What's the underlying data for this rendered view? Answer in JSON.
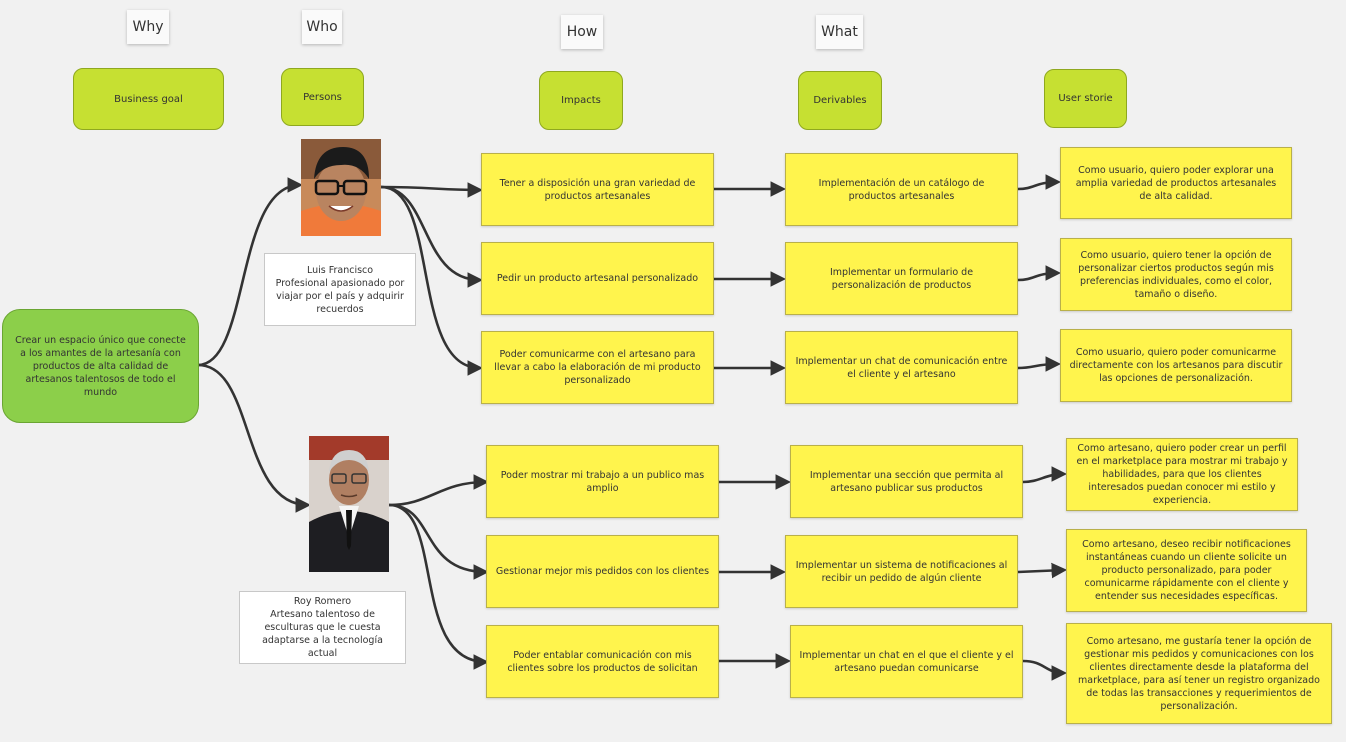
{
  "headers": {
    "why": "Why",
    "who": "Who",
    "how": "How",
    "what": "What"
  },
  "categories": {
    "business_goal": "Business goal",
    "persons": "Persons",
    "impacts": "Impacts",
    "derivables": "Derivables",
    "user_storie": "User storie"
  },
  "goal": "Crear un espacio único que conecte a los amantes de la artesanía con productos de alta calidad de artesanos talentosos de todo el mundo",
  "personas": [
    {
      "name": "Luis Francisco",
      "description": "Profesional apasionado por viajar por el país y adquirir recuerdos"
    },
    {
      "name": "Roy Romero",
      "description": "Artesano talentoso de esculturas que le cuesta adaptarse a la tecnología actual"
    }
  ],
  "impacts": [
    "Tener a disposición una gran variedad de productos artesanales",
    "Pedir un producto artesanal personalizado",
    "Poder comunicarme con el artesano para llevar a cabo la elaboración de mi producto personalizado",
    "Poder mostrar mi trabajo a un publico mas amplio",
    "Gestionar mejor mis pedidos con los clientes",
    "Poder entablar comunicación con mis clientes sobre los productos de solicitan"
  ],
  "derivables": [
    "Implementación de un catálogo de productos artesanales",
    "Implementar un formulario de personalización de productos",
    "Implementar un chat de comunicación entre el cliente y el artesano",
    "Implementar una  sección que permita al artesano publicar sus productos",
    "Implementar un sistema de notificaciones al recibir un pedido de algún cliente",
    "Implementar un chat en el que el cliente y el artesano puedan comunicarse"
  ],
  "user_stories": [
    "Como usuario, quiero poder explorar una amplia variedad de productos artesanales de alta calidad.",
    "Como usuario, quiero tener la opción de personalizar ciertos productos según mis preferencias individuales, como el color, tamaño o diseño.",
    "Como usuario, quiero poder comunicarme directamente con los artesanos para discutir las opciones de personalización.",
    "Como artesano, quiero poder crear un perfil en el marketplace para mostrar mi trabajo y habilidades, para que los clientes interesados puedan conocer mi estilo y experiencia.",
    "Como artesano, deseo recibir notificaciones instantáneas cuando un cliente solicite un producto personalizado, para poder comunicarme rápidamente con el cliente y entender sus necesidades específicas.",
    "Como artesano, me gustaría tener la opción de gestionar mis pedidos y comunicaciones con los clientes directamente desde la plataforma del marketplace, para así tener un registro organizado de todas las transacciones y requerimientos de personalización."
  ],
  "colors": {
    "background": "#f1f1f1",
    "category_green": "#c6e032",
    "goal_green": "#8ccf4a",
    "sticky_yellow": "#fff44d",
    "connector": "#333333"
  }
}
